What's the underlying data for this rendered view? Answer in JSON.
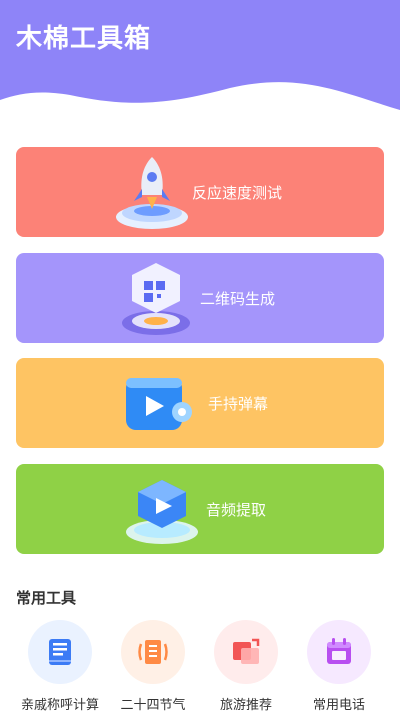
{
  "app": {
    "title": "木棉工具箱"
  },
  "cards": [
    {
      "label": "反应速度测试",
      "color": "#FC8277",
      "icon": "rocket-icon"
    },
    {
      "label": "二维码生成",
      "color": "#A495FB",
      "icon": "qr-code-icon"
    },
    {
      "label": "手持弹幕",
      "color": "#FEC463",
      "icon": "video-play-icon"
    },
    {
      "label": "音频提取",
      "color": "#8FD146",
      "icon": "audio-play-icon"
    }
  ],
  "section": {
    "title": "常用工具"
  },
  "tools": [
    {
      "label": "亲戚称呼计算",
      "icon": "book-icon",
      "bg": "#EAF2FF",
      "fg": "#3C7BF5"
    },
    {
      "label": "二十四节气",
      "icon": "scroll-icon",
      "bg": "#FFF0E6",
      "fg": "#FF8A45"
    },
    {
      "label": "旅游推荐",
      "icon": "travel-icon",
      "bg": "#FFECEC",
      "fg": "#F25555"
    },
    {
      "label": "常用电话",
      "icon": "calendar-icon",
      "bg": "#F6E9FF",
      "fg": "#B84FF0"
    }
  ],
  "colors": {
    "header": "#8E84F8"
  }
}
